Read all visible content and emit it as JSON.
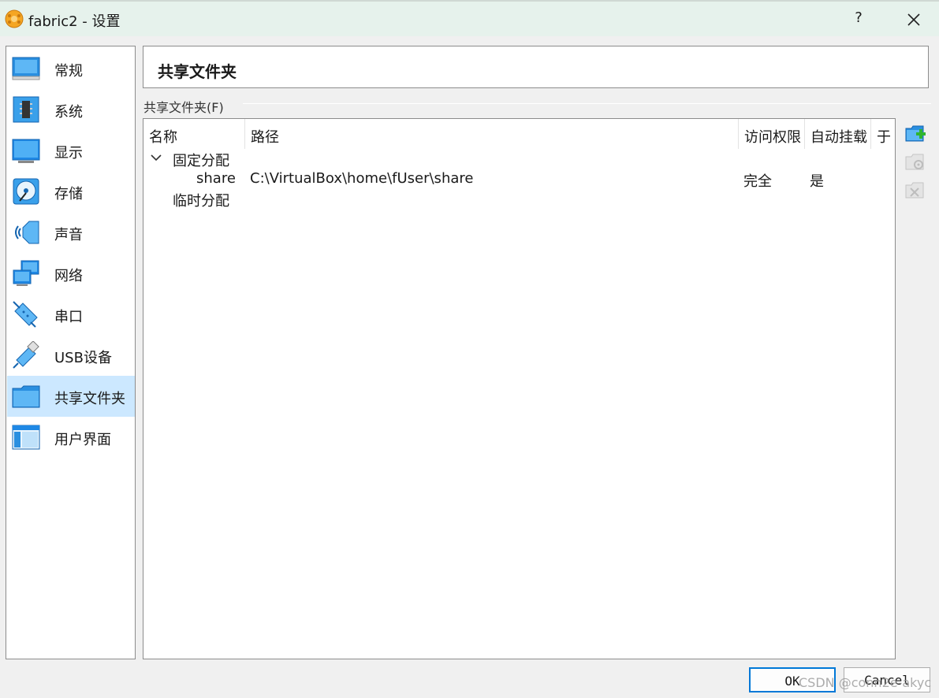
{
  "window": {
    "title": "fabric2 - 设置",
    "help_label": "?"
  },
  "sidebar": {
    "items": [
      {
        "label": "常规",
        "icon": "general-icon"
      },
      {
        "label": "系统",
        "icon": "system-icon"
      },
      {
        "label": "显示",
        "icon": "display-icon"
      },
      {
        "label": "存储",
        "icon": "storage-icon"
      },
      {
        "label": "声音",
        "icon": "audio-icon"
      },
      {
        "label": "网络",
        "icon": "network-icon"
      },
      {
        "label": "串口",
        "icon": "serial-port-icon"
      },
      {
        "label": "USB设备",
        "icon": "usb-icon"
      },
      {
        "label": "共享文件夹",
        "icon": "shared-folder-icon",
        "selected": true
      },
      {
        "label": "用户界面",
        "icon": "user-interface-icon"
      }
    ]
  },
  "page": {
    "title": "共享文件夹",
    "group_label": "共享文件夹(F)"
  },
  "table": {
    "columns": [
      "名称",
      "路径",
      "访问权限",
      "自动挂载",
      "于"
    ],
    "groups": [
      {
        "label": "固定分配",
        "expanded": true,
        "rows": [
          {
            "name": "share",
            "path": "C:\\VirtualBox\\home\\fUser\\share",
            "access": "完全",
            "automount": "是",
            "at": ""
          }
        ]
      },
      {
        "label": "临时分配",
        "expanded": false,
        "rows": []
      }
    ]
  },
  "tools": {
    "add_icon": "add-shared-folder-icon",
    "edit_icon": "edit-shared-folder-icon",
    "remove_icon": "remove-shared-folder-icon"
  },
  "buttons": {
    "ok": "OK",
    "cancel": "Cancel"
  },
  "watermark": "CSDN @conn2e-akyc"
}
